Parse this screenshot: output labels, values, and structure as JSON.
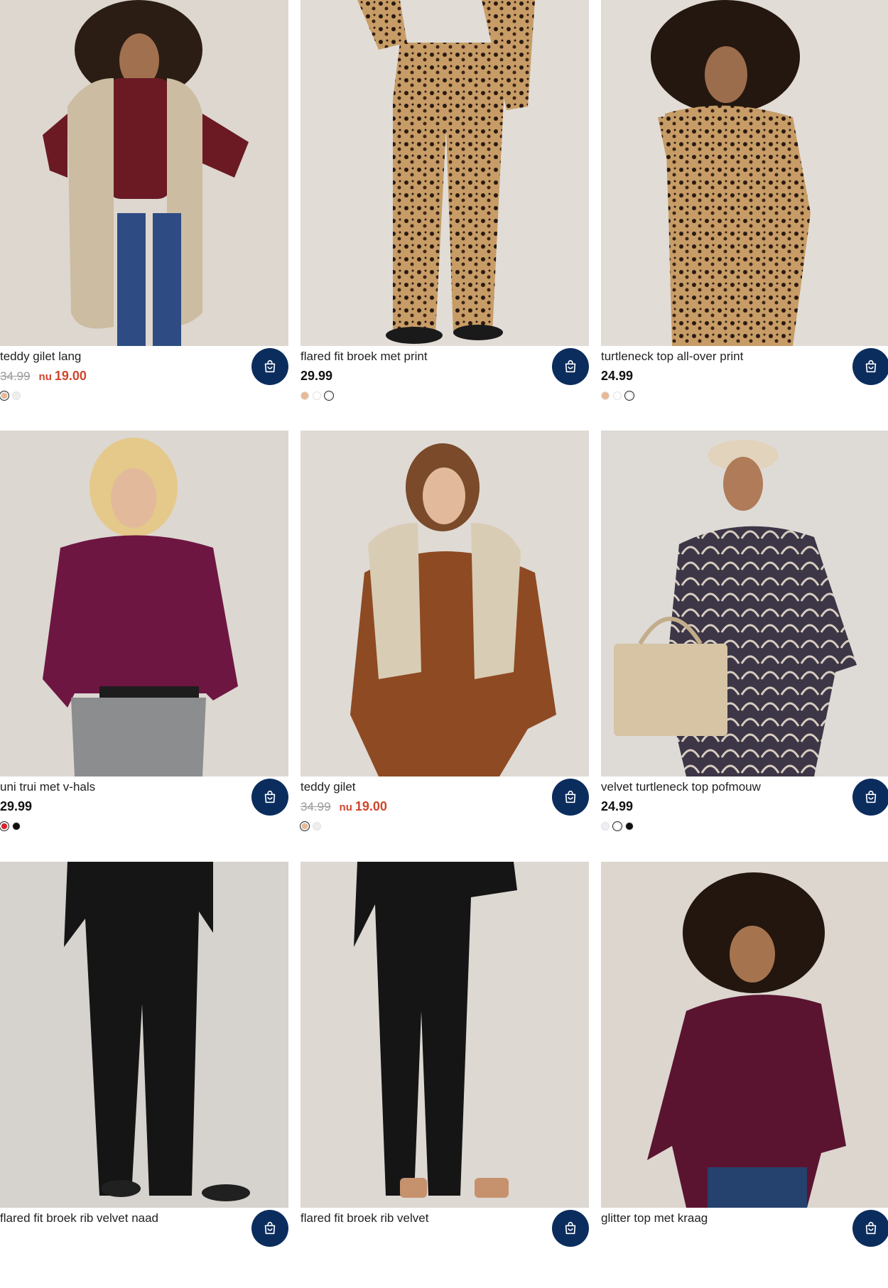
{
  "products": [
    {
      "title": "teddy gilet lang",
      "price": "",
      "old_price": "34.99",
      "sale_label": "nu",
      "sale_price": "19.00",
      "swatches": [
        "#e9b895",
        "#eeeeee"
      ],
      "selected": 0
    },
    {
      "title": "flared fit broek met print",
      "price": "29.99",
      "old_price": "",
      "sale_label": "",
      "sale_price": "",
      "swatches": [
        "#e9b895",
        "#ffffff",
        "#ffffff"
      ],
      "selected": 2
    },
    {
      "title": "turtleneck top all-over print",
      "price": "24.99",
      "old_price": "",
      "sale_label": "",
      "sale_price": "",
      "swatches": [
        "#e9b895",
        "#ffffff",
        "#ffffff"
      ],
      "selected": 2
    },
    {
      "title": "uni trui met v-hals",
      "price": "29.99",
      "old_price": "",
      "sale_label": "",
      "sale_price": "",
      "swatches": [
        "#d9202a",
        "#111111"
      ],
      "selected": 0
    },
    {
      "title": "teddy gilet",
      "price": "",
      "old_price": "34.99",
      "sale_label": "nu",
      "sale_price": "19.00",
      "swatches": [
        "#e9b895",
        "#eeeeee"
      ],
      "selected": 0
    },
    {
      "title": "velvet turtleneck top pofmouw",
      "price": "24.99",
      "old_price": "",
      "sale_label": "",
      "sale_price": "",
      "swatches": [
        "#eeeef4",
        "#ffffff",
        "#111111"
      ],
      "selected": 1
    },
    {
      "title": "flared fit broek rib velvet naad",
      "price": "",
      "old_price": "",
      "sale_label": "",
      "sale_price": "",
      "swatches": [],
      "selected": -1
    },
    {
      "title": "flared fit broek rib velvet",
      "price": "",
      "old_price": "",
      "sale_label": "",
      "sale_price": "",
      "swatches": [],
      "selected": -1
    },
    {
      "title": "glitter top met kraag",
      "price": "",
      "old_price": "",
      "sale_label": "",
      "sale_price": "",
      "swatches": [],
      "selected": -1
    }
  ],
  "colors": {
    "accent": "#0b2d5e",
    "sale": "#d0462c"
  },
  "icons": {
    "cart": "shopping-bag-icon"
  }
}
